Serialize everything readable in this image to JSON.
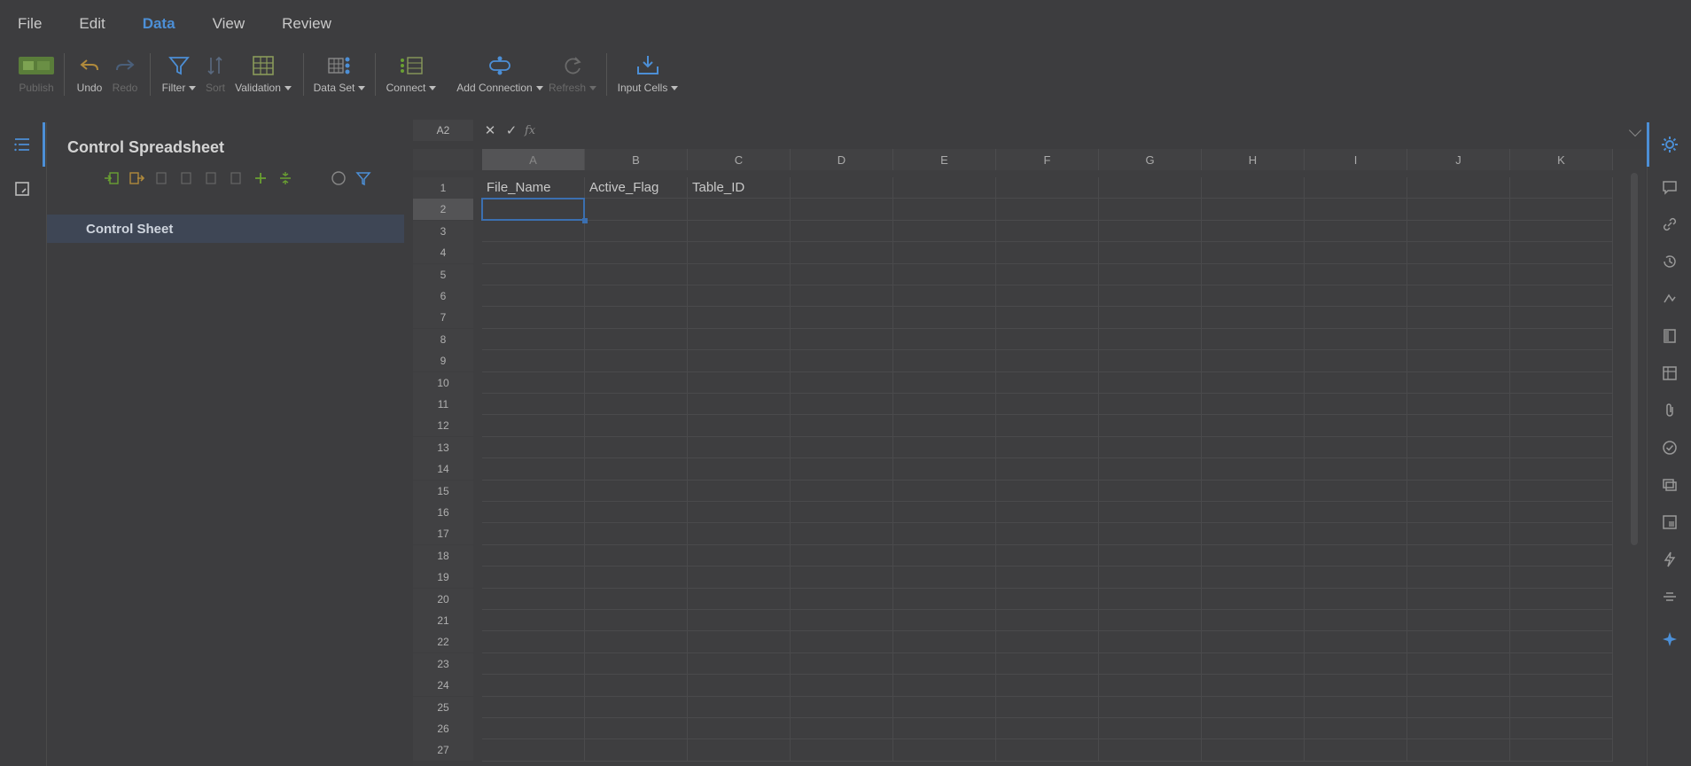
{
  "menu": {
    "items": [
      {
        "label": "File",
        "active": false
      },
      {
        "label": "Edit",
        "active": false
      },
      {
        "label": "Data",
        "active": true
      },
      {
        "label": "View",
        "active": false
      },
      {
        "label": "Review",
        "active": false
      }
    ]
  },
  "ribbon": {
    "publish": "Publish",
    "undo": "Undo",
    "redo": "Redo",
    "filter": "Filter",
    "sort": "Sort",
    "validation": "Validation",
    "data_set": "Data Set",
    "connect": "Connect",
    "add_connection": "Add Connection",
    "refresh": "Refresh",
    "input_cells": "Input Cells"
  },
  "panel": {
    "title": "Control Spreadsheet",
    "sheets": [
      "Control Sheet"
    ]
  },
  "formula_bar": {
    "name_box": "A2",
    "fx": "fx",
    "value": ""
  },
  "grid": {
    "columns": [
      "A",
      "B",
      "C",
      "D",
      "E",
      "F",
      "G",
      "H",
      "I",
      "J",
      "K"
    ],
    "rows": [
      "1",
      "2",
      "3",
      "4",
      "5",
      "6",
      "7",
      "8",
      "9",
      "10",
      "11",
      "12",
      "13",
      "14",
      "15",
      "16",
      "17",
      "18",
      "19",
      "20",
      "21",
      "22",
      "23",
      "24",
      "25",
      "26",
      "27"
    ],
    "selected_cell": "A2",
    "cells": {
      "A1": "File_Name",
      "B1": "Active_Flag",
      "C1": "Table_ID"
    }
  },
  "colors": {
    "accent": "#4c8fd6",
    "publish_green": "#6aa032",
    "selection": "#3b6fb0"
  }
}
